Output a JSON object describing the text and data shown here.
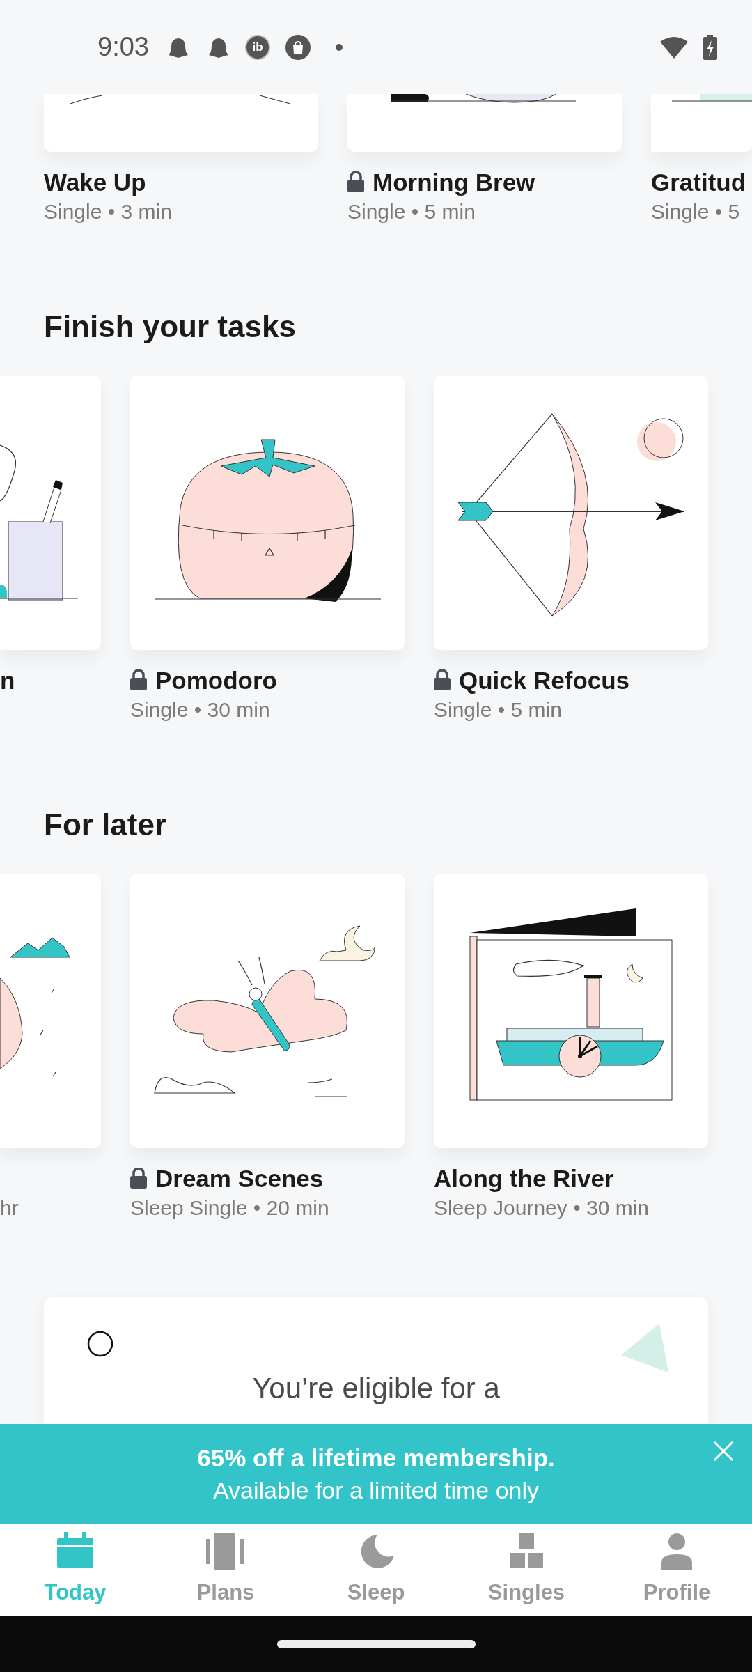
{
  "status_bar": {
    "time": "9:03",
    "badge": "ib"
  },
  "carousels": [
    {
      "cards": [
        {
          "title": "Wake Up",
          "subtitle": "Single • 3 min",
          "locked": false
        },
        {
          "title": "Morning Brew",
          "subtitle": "Single • 5 min",
          "locked": true
        },
        {
          "title": "Gratitud",
          "subtitle": "Single • 5",
          "locked": false
        }
      ]
    },
    {
      "heading": "Finish your tasks",
      "cards": [
        {
          "title": "n"
        },
        {
          "title": "Pomodoro",
          "subtitle": "Single • 30 min",
          "locked": true
        },
        {
          "title": "Quick Refocus",
          "subtitle": "Single • 5 min",
          "locked": true
        }
      ]
    },
    {
      "heading": "For later",
      "cards": [
        {
          "subtitle": "hr"
        },
        {
          "title": "Dream Scenes",
          "subtitle": "Sleep Single • 20 min",
          "locked": true
        },
        {
          "title": "Along the River",
          "subtitle": "Sleep Journey • 30 min",
          "locked": false
        }
      ]
    }
  ],
  "promo_card": {
    "text": "You’re eligible for a"
  },
  "banner": {
    "title": "65% off a lifetime membership.",
    "subtitle": "Available for a limited time only"
  },
  "nav": [
    {
      "label": "Today",
      "selected": true
    },
    {
      "label": "Plans",
      "selected": false
    },
    {
      "label": "Sleep",
      "selected": false
    },
    {
      "label": "Singles",
      "selected": false
    },
    {
      "label": "Profile",
      "selected": false
    }
  ]
}
